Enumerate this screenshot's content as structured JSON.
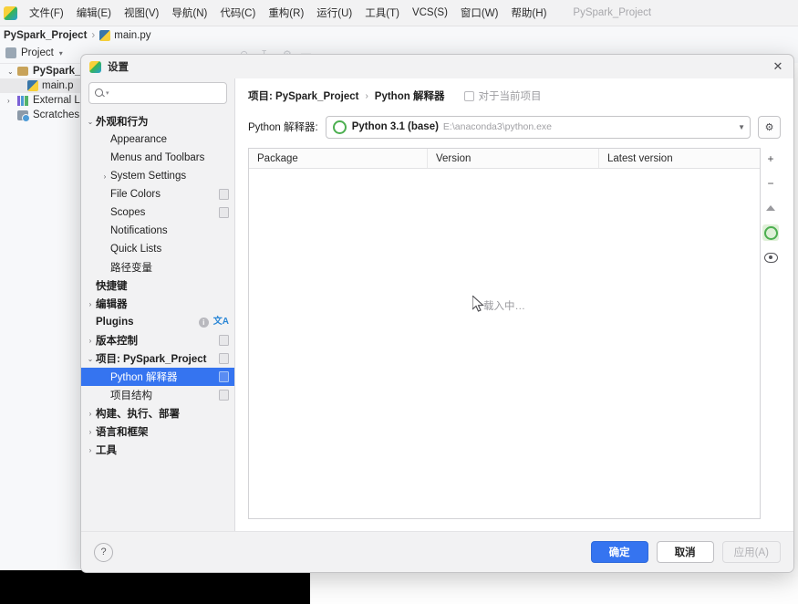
{
  "ide": {
    "window_title": "PySpark_Project",
    "menu": [
      {
        "label": "文件(F)",
        "name": "menu-file"
      },
      {
        "label": "编辑(E)",
        "name": "menu-edit"
      },
      {
        "label": "视图(V)",
        "name": "menu-view"
      },
      {
        "label": "导航(N)",
        "name": "menu-navigate"
      },
      {
        "label": "代码(C)",
        "name": "menu-code"
      },
      {
        "label": "重构(R)",
        "name": "menu-refactor"
      },
      {
        "label": "运行(U)",
        "name": "menu-run"
      },
      {
        "label": "工具(T)",
        "name": "menu-tools"
      },
      {
        "label": "VCS(S)",
        "name": "menu-vcs"
      },
      {
        "label": "窗口(W)",
        "name": "menu-window"
      },
      {
        "label": "帮助(H)",
        "name": "menu-help"
      }
    ],
    "breadcrumb": {
      "project": "PySpark_Project",
      "separator": "›",
      "file": "main.py"
    },
    "project_tool": {
      "title": "Project",
      "caret": "▾"
    },
    "project_tree": [
      {
        "arrow": "⌄",
        "label": "PySpark_P",
        "bold": true,
        "icon": "folder-icon"
      },
      {
        "arrow": "",
        "label": "main.p",
        "bold": false,
        "icon": "python-file-icon",
        "selected": true
      },
      {
        "arrow": "›",
        "label": "External Li",
        "bold": false,
        "icon": "external-libraries-icon"
      },
      {
        "arrow": "",
        "label": "Scratches",
        "bold": false,
        "icon": "scratches-icon"
      }
    ]
  },
  "dialog": {
    "title": "设置",
    "close_label": "✕",
    "search": {
      "value": "",
      "placeholder": ""
    },
    "tree": [
      {
        "arrow": "⌄",
        "label": "外观和行为",
        "bold": true,
        "indent": 0,
        "badge": "",
        "selected": false
      },
      {
        "arrow": "",
        "label": "Appearance",
        "bold": false,
        "indent": 1,
        "badge": "",
        "selected": false
      },
      {
        "arrow": "",
        "label": "Menus and Toolbars",
        "bold": false,
        "indent": 1,
        "badge": "",
        "selected": false
      },
      {
        "arrow": "›",
        "label": "System Settings",
        "bold": false,
        "indent": 1,
        "badge": "",
        "selected": false
      },
      {
        "arrow": "",
        "label": "File Colors",
        "bold": false,
        "indent": 1,
        "badge": "page",
        "selected": false
      },
      {
        "arrow": "",
        "label": "Scopes",
        "bold": false,
        "indent": 1,
        "badge": "page",
        "selected": false
      },
      {
        "arrow": "",
        "label": "Notifications",
        "bold": false,
        "indent": 1,
        "badge": "",
        "selected": false
      },
      {
        "arrow": "",
        "label": "Quick Lists",
        "bold": false,
        "indent": 1,
        "badge": "",
        "selected": false
      },
      {
        "arrow": "",
        "label": "路径变量",
        "bold": false,
        "indent": 1,
        "badge": "",
        "selected": false
      },
      {
        "arrow": "",
        "label": "快捷键",
        "bold": true,
        "indent": 0,
        "badge": "",
        "selected": false
      },
      {
        "arrow": "›",
        "label": "编辑器",
        "bold": true,
        "indent": 0,
        "badge": "",
        "selected": false
      },
      {
        "arrow": "",
        "label": "Plugins",
        "bold": true,
        "indent": 0,
        "badge": "info-translate",
        "selected": false
      },
      {
        "arrow": "›",
        "label": "版本控制",
        "bold": true,
        "indent": 0,
        "badge": "page",
        "selected": false
      },
      {
        "arrow": "⌄",
        "label": "项目: PySpark_Project",
        "bold": true,
        "indent": 0,
        "badge": "page",
        "selected": false
      },
      {
        "arrow": "",
        "label": "Python 解释器",
        "bold": false,
        "indent": 1,
        "badge": "page",
        "selected": true
      },
      {
        "arrow": "",
        "label": "项目结构",
        "bold": false,
        "indent": 1,
        "badge": "page",
        "selected": false
      },
      {
        "arrow": "›",
        "label": "构建、执行、部署",
        "bold": true,
        "indent": 0,
        "badge": "",
        "selected": false
      },
      {
        "arrow": "›",
        "label": "语言和框架",
        "bold": true,
        "indent": 0,
        "badge": "",
        "selected": false
      },
      {
        "arrow": "›",
        "label": "工具",
        "bold": true,
        "indent": 0,
        "badge": "",
        "selected": false
      }
    ],
    "breadcrumb": {
      "project_part": "项目: PySpark_Project",
      "separator": "›",
      "page_part": "Python 解释器",
      "scope_hint": "对于当前项目"
    },
    "interpreter": {
      "label": "Python 解释器:",
      "name": "Python 3.1 (base)",
      "path": "E:\\anaconda3\\python.exe",
      "caret": "▼",
      "gear": "⚙"
    },
    "packages": {
      "columns": [
        "Package",
        "Version",
        "Latest version"
      ],
      "rows": [],
      "loading_text": "载入中…",
      "toolbar": [
        {
          "name": "add-package-button",
          "glyph": "+"
        },
        {
          "name": "remove-package-button",
          "glyph": "−"
        },
        {
          "name": "upgrade-package-button",
          "glyph": "▲"
        },
        {
          "name": "install-progress-icon",
          "glyph": "◯"
        },
        {
          "name": "show-early-releases-button",
          "glyph": "◉"
        }
      ]
    },
    "footer": {
      "help": "?",
      "ok": "确定",
      "cancel": "取消",
      "apply": "应用(A)"
    }
  },
  "colors": {
    "accent": "#3574f0",
    "selection": "#3574f0",
    "python_green": "#4caf50",
    "dialog_bg": "#f2f2f3"
  }
}
